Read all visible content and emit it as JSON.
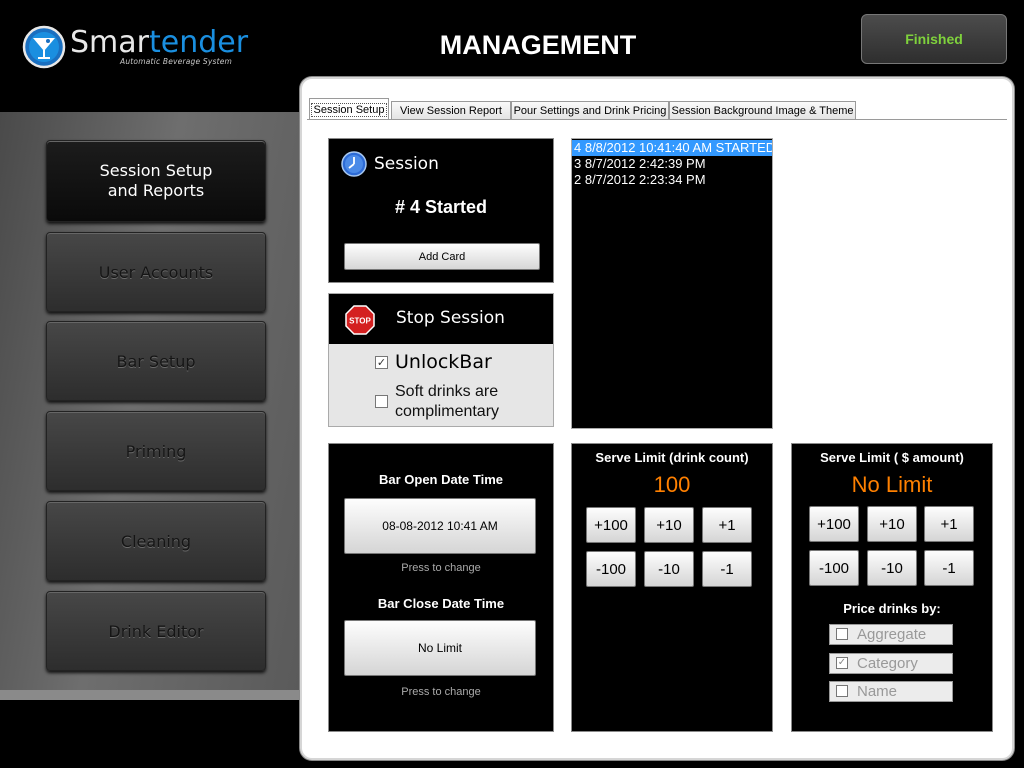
{
  "header": {
    "logo_name_part1": "Smar",
    "logo_name_part2": "tender",
    "logo_tagline": "Automatic Beverage System",
    "title": "MANAGEMENT",
    "finished_label": "Finished"
  },
  "nav": {
    "items": [
      {
        "label": "Session Setup and Reports",
        "active": true
      },
      {
        "label": "User Accounts"
      },
      {
        "label": "Bar Setup"
      },
      {
        "label": "Priming"
      },
      {
        "label": "Cleaning"
      },
      {
        "label": "Drink Editor"
      }
    ]
  },
  "tabs": [
    {
      "label": "Session Setup",
      "active": true
    },
    {
      "label": "View Session Report"
    },
    {
      "label": "Pour Settings and Drink Pricing"
    },
    {
      "label": "Session Background Image & Theme"
    }
  ],
  "session": {
    "title": "Session",
    "status": "# 4 Started",
    "add_card_label": "Add Card"
  },
  "stop_session": {
    "label": "Stop Session",
    "unlock_bar_label": "UnlockBar",
    "unlock_bar_checked": true,
    "soft_drinks_label": "Soft drinks are complimentary",
    "soft_drinks_checked": false
  },
  "session_list": {
    "items": [
      {
        "label": "4 8/8/2012 10:41:40 AM STARTED",
        "selected": true
      },
      {
        "label": "3 8/7/2012 2:42:39 PM"
      },
      {
        "label": "2 8/7/2012 2:23:34 PM"
      }
    ]
  },
  "bar_times": {
    "open_label": "Bar Open Date Time",
    "open_value": "08-08-2012  10:41 AM",
    "open_hint": "Press to change",
    "close_label": "Bar Close Date Time",
    "close_value": "No Limit",
    "close_hint": "Press to change"
  },
  "serve_limit_count": {
    "title": "Serve Limit (drink count)",
    "value": "100",
    "buttons": [
      "+100",
      "+10",
      "+1",
      "-100",
      "-10",
      "-1"
    ]
  },
  "serve_limit_amount": {
    "title": "Serve Limit ( $ amount)",
    "value": "No Limit",
    "buttons": [
      "+100",
      "+10",
      "+1",
      "-100",
      "-10",
      "-1"
    ],
    "price_by_label": "Price drinks by:",
    "price_options": [
      {
        "label": "Aggregate",
        "checked": false
      },
      {
        "label": "Category",
        "checked": true
      },
      {
        "label": "Name",
        "checked": false
      }
    ]
  },
  "colors": {
    "accent_blue": "#1a8fe0",
    "finished_green": "#7fd23c",
    "serve_value_orange": "#ff8000",
    "list_selection": "#3399ff"
  }
}
